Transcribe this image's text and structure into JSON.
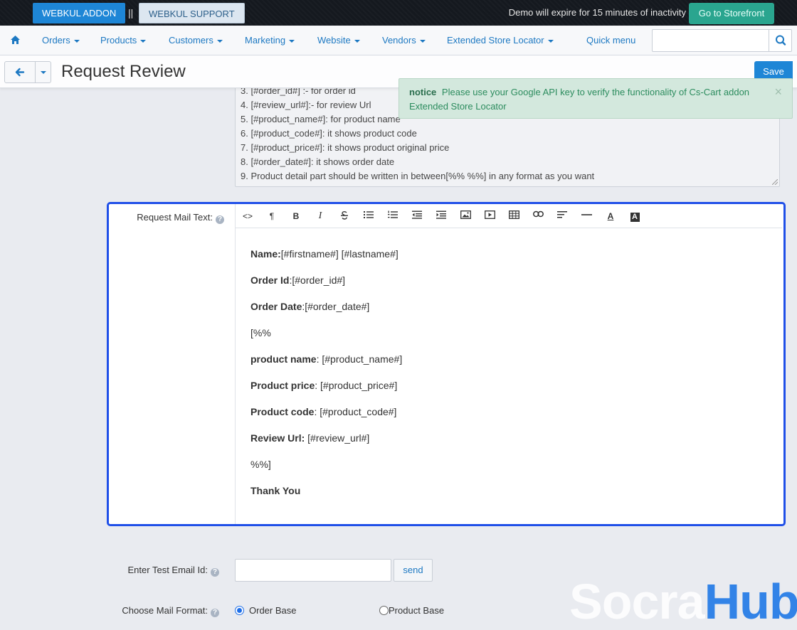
{
  "topbar": {
    "addon_label": "WEBKUL ADDON",
    "separator": "||",
    "support_label": "WEBKUL SUPPORT",
    "demo_notice": "Demo will expire for 15 minutes of inactivity",
    "storefront_label": "Go to Storefront"
  },
  "nav": {
    "items": [
      "Orders",
      "Products",
      "Customers",
      "Marketing",
      "Website",
      "Vendors",
      "Extended Store Locator"
    ],
    "quick_menu": "Quick menu",
    "search_value": ""
  },
  "titlebar": {
    "title": "Request Review",
    "save_label": "Save"
  },
  "notification": {
    "type": "notice",
    "message": "Please use your Google API key to verify the functionality of Cs-Cart addon Extended Store Locator"
  },
  "instructions": [
    "3. [#order_id#] :- for order id",
    "4. [#review_url#]:- for review Url",
    "5. [#product_name#]: for product name",
    "6. [#product_code#]: it shows product code",
    "7. [#product_price#]: it shows product original price",
    "8. [#order_date#]: it shows order date",
    "9. Product detail part should be written in between[%% %%] in any format as you want"
  ],
  "editor": {
    "label": "Request Mail Text:",
    "help": "?",
    "toolbar_glyphs": {
      "code": "<>",
      "paragraph": "¶",
      "bold": "B",
      "italic": "I",
      "font_color": "A",
      "bg_color": "A"
    },
    "lines": [
      {
        "bold": "Name:",
        "text": "[#firstname#] [#lastname#]"
      },
      {
        "bold": "Order Id",
        "text": ":[#order_id#]"
      },
      {
        "bold": "Order Date",
        "text": ":[#order_date#]"
      },
      {
        "bold": "",
        "text": "[%%"
      },
      {
        "bold": "product name",
        "text": ": [#product_name#]"
      },
      {
        "bold": "Product price",
        "text": ": [#product_price#]"
      },
      {
        "bold": "Product code",
        "text": ": [#product_code#]"
      },
      {
        "bold": "Review Url:",
        "text": " [#review_url#]"
      },
      {
        "bold": "",
        "text": "%%]"
      },
      {
        "bold": "Thank You",
        "text": ""
      }
    ]
  },
  "test_email": {
    "label": "Enter Test Email Id:",
    "help": "?",
    "value": "",
    "send_label": "send"
  },
  "mail_format": {
    "label": "Choose Mail Format:",
    "help": "?",
    "options": [
      "Order Base",
      "Product Base"
    ],
    "selected": "Order Base"
  },
  "watermark": {
    "part1": "Socra",
    "part2": "Hub"
  },
  "colors": {
    "accent": "#1e86d6",
    "link": "#1c78c2",
    "focus_border": "#1f4fe8",
    "notice_bg": "#d3e8dd",
    "notice_text": "#2c8c5e",
    "storefront": "#2aa58f"
  }
}
